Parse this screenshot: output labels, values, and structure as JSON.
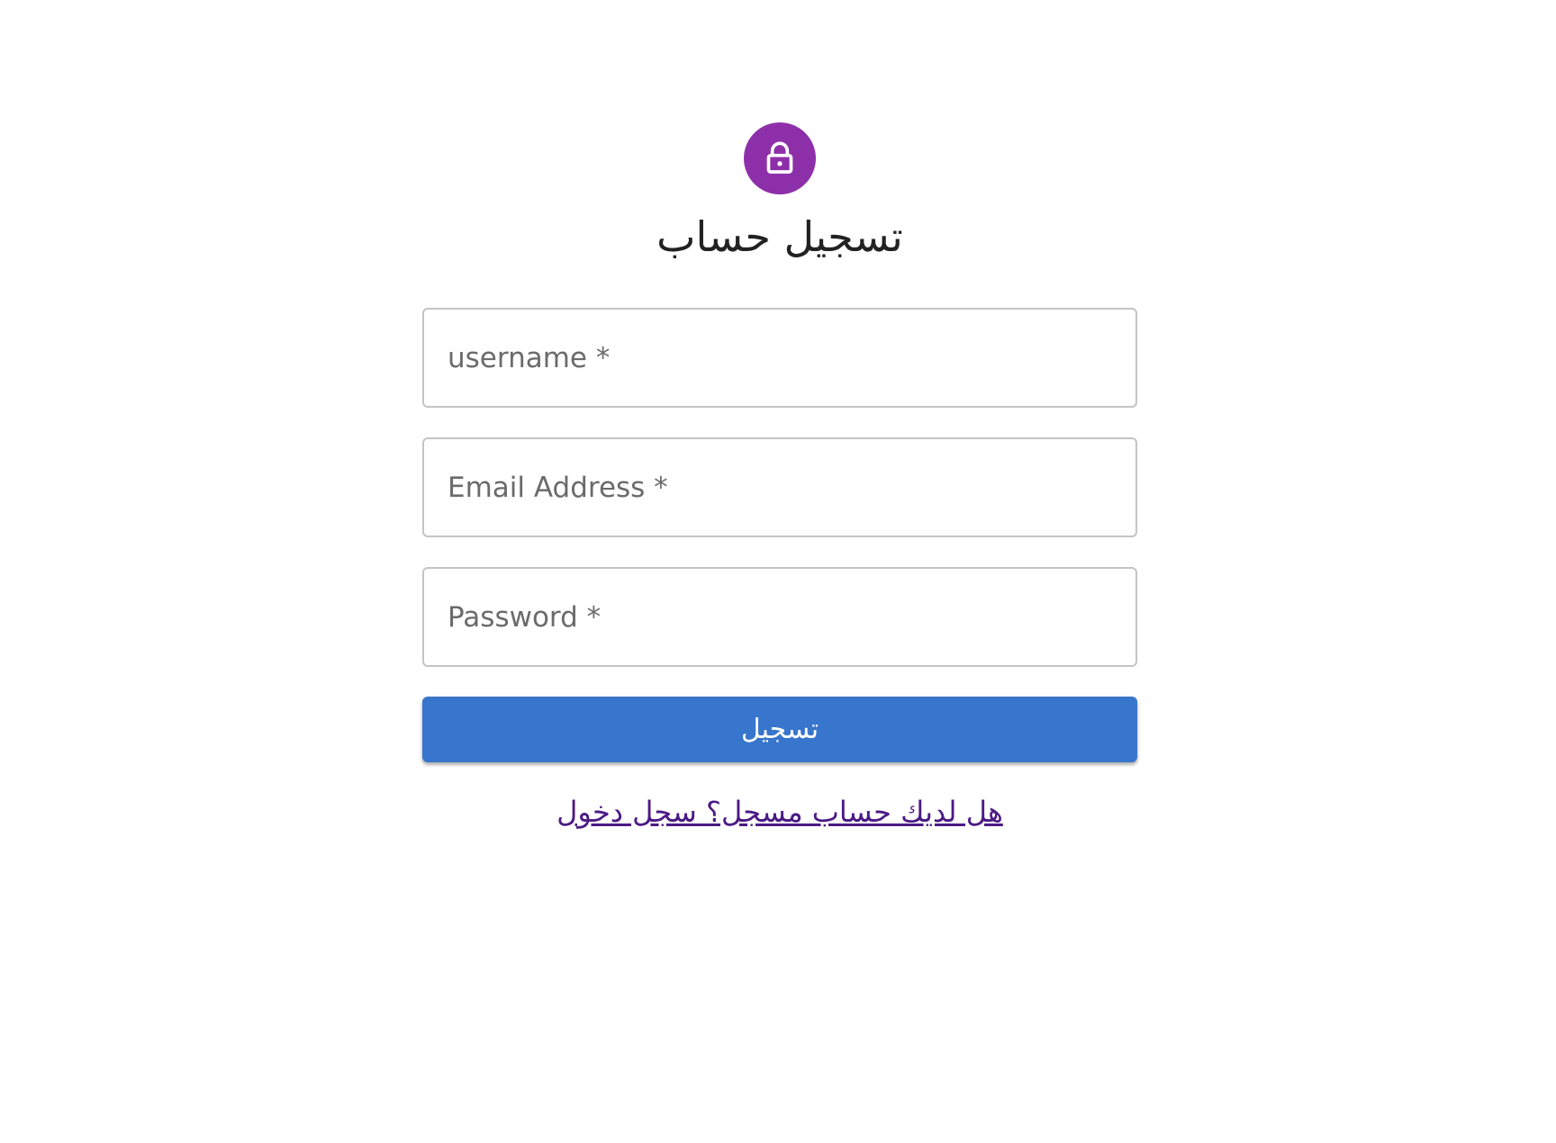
{
  "header": {
    "icon": "lock-icon",
    "icon_bg_color": "#8e2faa",
    "title": "تسجيل حساب"
  },
  "form": {
    "fields": [
      {
        "label": "username *",
        "value": ""
      },
      {
        "label": "Email Address *",
        "value": ""
      },
      {
        "label": "Password *",
        "value": ""
      }
    ],
    "submit_label": "تسجيل",
    "submit_color": "#3875cc"
  },
  "footer": {
    "login_link": "هل لديك حساب مسجل؟ سجل دخول"
  }
}
